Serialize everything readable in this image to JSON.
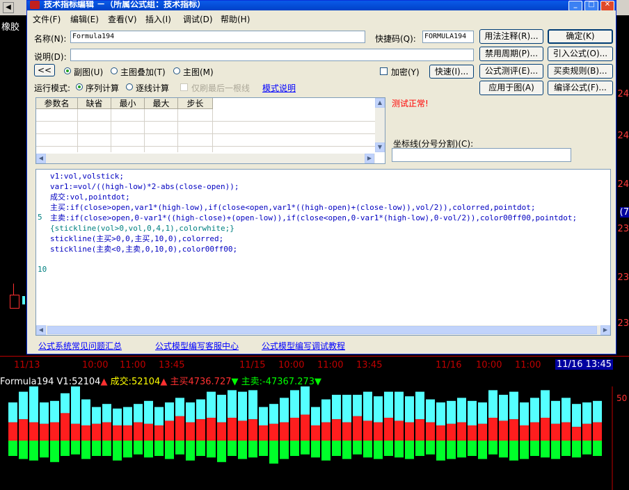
{
  "dialog": {
    "title": "技术指标编辑 －（所属公式组：技术指标）",
    "menu": [
      "文件(F)",
      "编辑(E)",
      "查看(V)",
      "插入(I)",
      "调试(D)",
      "帮助(H)"
    ],
    "name_label": "名称(N):",
    "name_value": "Formula194",
    "shortcut_label": "快捷码(Q):",
    "shortcut_value": "FORMULA194",
    "desc_label": "说明(D):",
    "desc_value": "",
    "collapse_btn": "<<",
    "radio_sub": "副图(U)",
    "radio_overlay": "主图叠加(T)",
    "radio_main": "主图(M)",
    "encrypt_label": "加密(Y)",
    "quick_btn": "快速(I)...",
    "run_mode_label": "运行模式:",
    "radio_seq": "序列计算",
    "radio_bar": "逐线计算",
    "last_bar_label": "仅刷最后一根线",
    "mode_link": "模式说明",
    "buttons_right": [
      [
        "用法注释(R)...",
        "确定(K)"
      ],
      [
        "禁用周期(P)...",
        "引入公式(O)..."
      ],
      [
        "公式测评(E)...",
        "买卖规则(B)..."
      ],
      [
        "应用于图(A)",
        "编译公式(F)..."
      ]
    ],
    "param_headers": [
      "参数名",
      "缺省",
      "最小",
      "最大",
      "步长"
    ],
    "test_status": "测试正常!",
    "coord_label": "坐标线(分号分割)(C):",
    "coord_value": "",
    "code_lines": [
      "v1:vol,volstick;",
      "var1:=vol/((high-low)*2-abs(close-open));",
      "成交:vol,pointdot;",
      "主买:if(close>open,var1*(high-low),if(close<open,var1*((high-open)+(close-low)),vol/2)),colorred,pointdot;",
      "主卖:if(close>open,0-var1*((high-close)+(open-low)),if(close<open,0-var1*(high-low),0-vol/2)),color00ff00,pointdot;",
      "{stickline(vol>0,vol,0,4,1),colorwhite;}",
      "stickline(主买>0,0,主买,10,0),colorred;",
      "stickline(主卖<0,主卖,0,10,0),color00ff00;"
    ],
    "line_numbers": [
      "5",
      "10"
    ],
    "footer_links": [
      "公式系统常见问题汇总",
      "公式模型编写客服中心",
      "公式模型编写调试教程"
    ]
  },
  "background": {
    "left_label": "橡胶",
    "right_ticks": [
      "24",
      "24",
      "24",
      "23",
      "23",
      "23",
      "(7"
    ],
    "time_labels": [
      "11/13",
      "10:00",
      "11:00",
      "13:45",
      "11/15",
      "10:00",
      "11:00",
      "13:45",
      "11/16",
      "10:00",
      "11:00"
    ],
    "time_current": "11/16 13:45",
    "vol_axis_label": "50"
  },
  "indicator": {
    "name": "Formula194",
    "v1": "V1:52104",
    "cj": "成交:52104",
    "zm": "主买4736.727",
    "zs": "主卖:-47367.273",
    "colors": {
      "v1": "#ffffff",
      "cj": "#ffff00",
      "zm": "#ff3030",
      "zs": "#00ff00",
      "buy": "#ff1e1e",
      "sell": "#00ff2a",
      "vol": "#55ffff"
    }
  },
  "chart_data": {
    "type": "bar",
    "title": "",
    "series": [
      {
        "name": "主买",
        "values": [
          12,
          14,
          12,
          11,
          12,
          18,
          11,
          10,
          11,
          12,
          10,
          10,
          12,
          11,
          10,
          13,
          16,
          12,
          14,
          15,
          12,
          15,
          13,
          14,
          10,
          11,
          12,
          15,
          17,
          10,
          12,
          14,
          12,
          16,
          13,
          12,
          15,
          13,
          12,
          14,
          12,
          10,
          11,
          12,
          10,
          11,
          15,
          13,
          14,
          10,
          12,
          15,
          11,
          12,
          9,
          11,
          12
        ]
      },
      {
        "name": "主卖",
        "values": [
          -10,
          -12,
          -13,
          -11,
          -14,
          -10,
          -9,
          -12,
          -10,
          -10,
          -13,
          -11,
          -9,
          -11,
          -10,
          -12,
          -9,
          -13,
          -10,
          -11,
          -14,
          -10,
          -12,
          -11,
          -10,
          -15,
          -12,
          -10,
          -9,
          -11,
          -13,
          -10,
          -12,
          -9,
          -11,
          -12,
          -10,
          -11,
          -12,
          -10,
          -9,
          -13,
          -12,
          -11,
          -10,
          -12,
          -9,
          -11,
          -13,
          -12,
          -10,
          -11,
          -12,
          -10,
          -11,
          -9,
          -10
        ]
      },
      {
        "name": "V1",
        "values": [
          25,
          32,
          36,
          25,
          26,
          31,
          38,
          27,
          22,
          24,
          21,
          22,
          24,
          26,
          22,
          25,
          28,
          25,
          27,
          32,
          30,
          33,
          32,
          33,
          22,
          24,
          28,
          33,
          36,
          22,
          27,
          30,
          30,
          30,
          32,
          29,
          32,
          32,
          29,
          32,
          27,
          25,
          26,
          28,
          26,
          25,
          33,
          30,
          32,
          25,
          28,
          33,
          26,
          28,
          24,
          25,
          26
        ]
      }
    ]
  }
}
